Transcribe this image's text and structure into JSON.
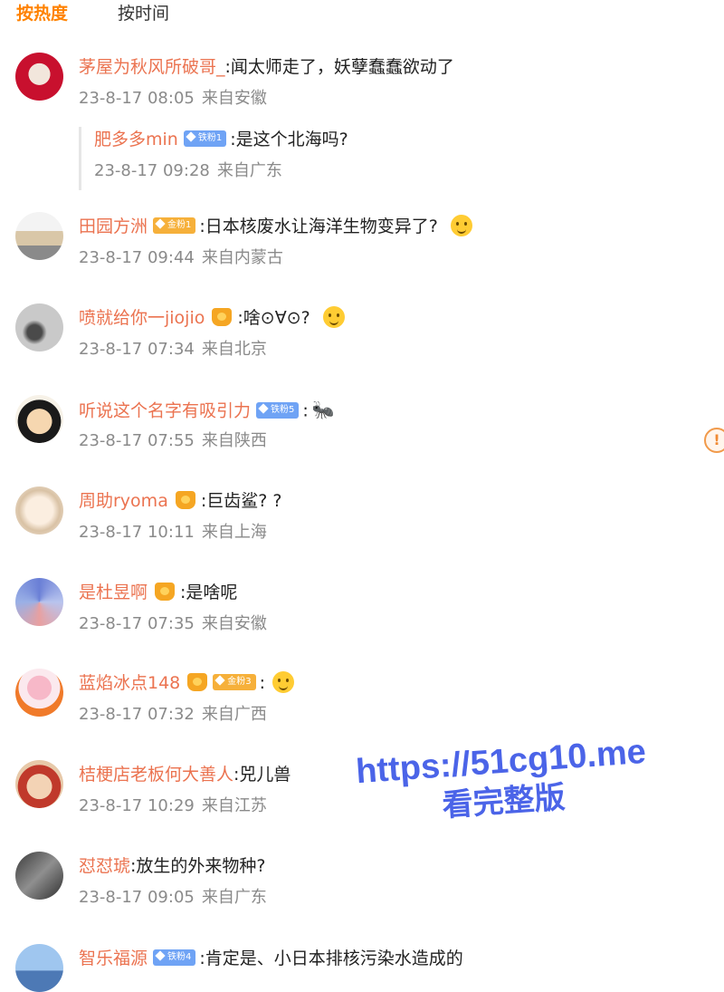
{
  "tabs": {
    "hot": "按热度",
    "time": "按时间"
  },
  "comments": [
    {
      "user": "茅屋为秋风所破哥_",
      "text": ":闻太师走了，妖孽蠢蠢欲动了",
      "time": "23-8-17 08:05",
      "location": "来自安徽",
      "reply": {
        "user": "肥多多min",
        "badge": "铁粉1",
        "text": ":是这个北海吗?",
        "time": "23-8-17 09:28",
        "location": "来自广东"
      }
    },
    {
      "user": "田园方洲",
      "badge": "金粉1",
      "text": ":日本核废水让海洋生物变异了? ",
      "time": "23-8-17 09:44",
      "location": "来自内蒙古"
    },
    {
      "user": "喷就给你一jiojio",
      "text": ":啥⊙∀⊙? ",
      "time": "23-8-17 07:34",
      "location": "来自北京"
    },
    {
      "user": "听说这个名字有吸引力",
      "badge": "铁粉5",
      "text": ":",
      "time": "23-8-17 07:55",
      "location": "来自陕西"
    },
    {
      "user": "周助ryoma",
      "text": ":巨齿鲨? ?",
      "time": "23-8-17 10:11",
      "location": "来自上海"
    },
    {
      "user": "是杜昱啊",
      "text": ":是啥呢",
      "time": "23-8-17 07:35",
      "location": "来自安徽"
    },
    {
      "user": "蓝焰冰点148",
      "badge": "金粉3",
      "text": ":",
      "time": "23-8-17 07:32",
      "location": "来自广西"
    },
    {
      "user": "桔梗店老板何大善人",
      "text": ":兕儿兽",
      "time": "23-8-17 10:29",
      "location": "来自江苏"
    },
    {
      "user": "怼怼琥",
      "text": ":放生的外来物种?",
      "time": "23-8-17 09:05",
      "location": "来自广东"
    },
    {
      "user": "智乐福源",
      "badge": "铁粉4",
      "text": ":肯定是、小日本排核污染水造成的"
    }
  ],
  "watermark": {
    "url": "https://51cg10.me",
    "sub": "看完整版"
  },
  "colors": {
    "accent": "#ff8200",
    "username": "#eb7350",
    "meta": "#8a8a8a",
    "badge_blue": "#6fa3f5",
    "badge_gold": "#f6b03a"
  }
}
